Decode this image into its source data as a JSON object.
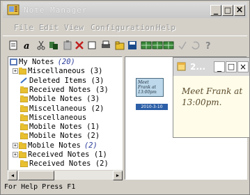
{
  "window": {
    "title": "Note Manager",
    "caption_buttons": {
      "minimize": "_",
      "maximize": "□",
      "close": "×"
    }
  },
  "menu": [
    "File",
    "Edit",
    "View",
    "Configuration",
    "Help"
  ],
  "toolbar_icons": [
    "new-note-icon",
    "font-icon",
    "cut-icon",
    "copy-icon",
    "paste-icon",
    "delete-icon",
    "blank-icon",
    "print-icon",
    "folder-icon",
    "save-icon",
    "grid-icon-1",
    "grid-icon-2",
    "grid-icon-3",
    "check-icon",
    "refresh-icon",
    "help-icon"
  ],
  "tree": {
    "items": [
      {
        "label": "My Notes",
        "count": "(20)",
        "expander": "",
        "italic": true
      },
      {
        "label": "Miscellaneous (3)",
        "expander": "+"
      },
      {
        "label": "Deleted Items (3)",
        "expander": ""
      },
      {
        "label": "Received Notes (3)",
        "expander": ""
      },
      {
        "label": "Mobile Notes (3)",
        "expander": ""
      },
      {
        "label": "Miscellaneous (2)",
        "expander": ""
      },
      {
        "label": "Miscellaneous",
        "expander": ""
      },
      {
        "label": "Mobile Notes (1)",
        "expander": ""
      },
      {
        "label": "Mobile Notes (2)",
        "expander": ""
      },
      {
        "label": "Mobile Notes",
        "count": "(2)",
        "expander": "+"
      },
      {
        "label": "Received Notes (1)",
        "expander": "+"
      },
      {
        "label": "Received Notes (2)",
        "expander": ""
      }
    ]
  },
  "thumbnail_note": {
    "text": "Meet Frank at 13:00pm",
    "date": "2010-3-10"
  },
  "note_window": {
    "title": "2...",
    "body": "Meet Frank at 13:00pm.",
    "buttons": {
      "minimize": "_",
      "maximize": "□",
      "close": "×"
    }
  },
  "status_bar": "For Help Press F1"
}
